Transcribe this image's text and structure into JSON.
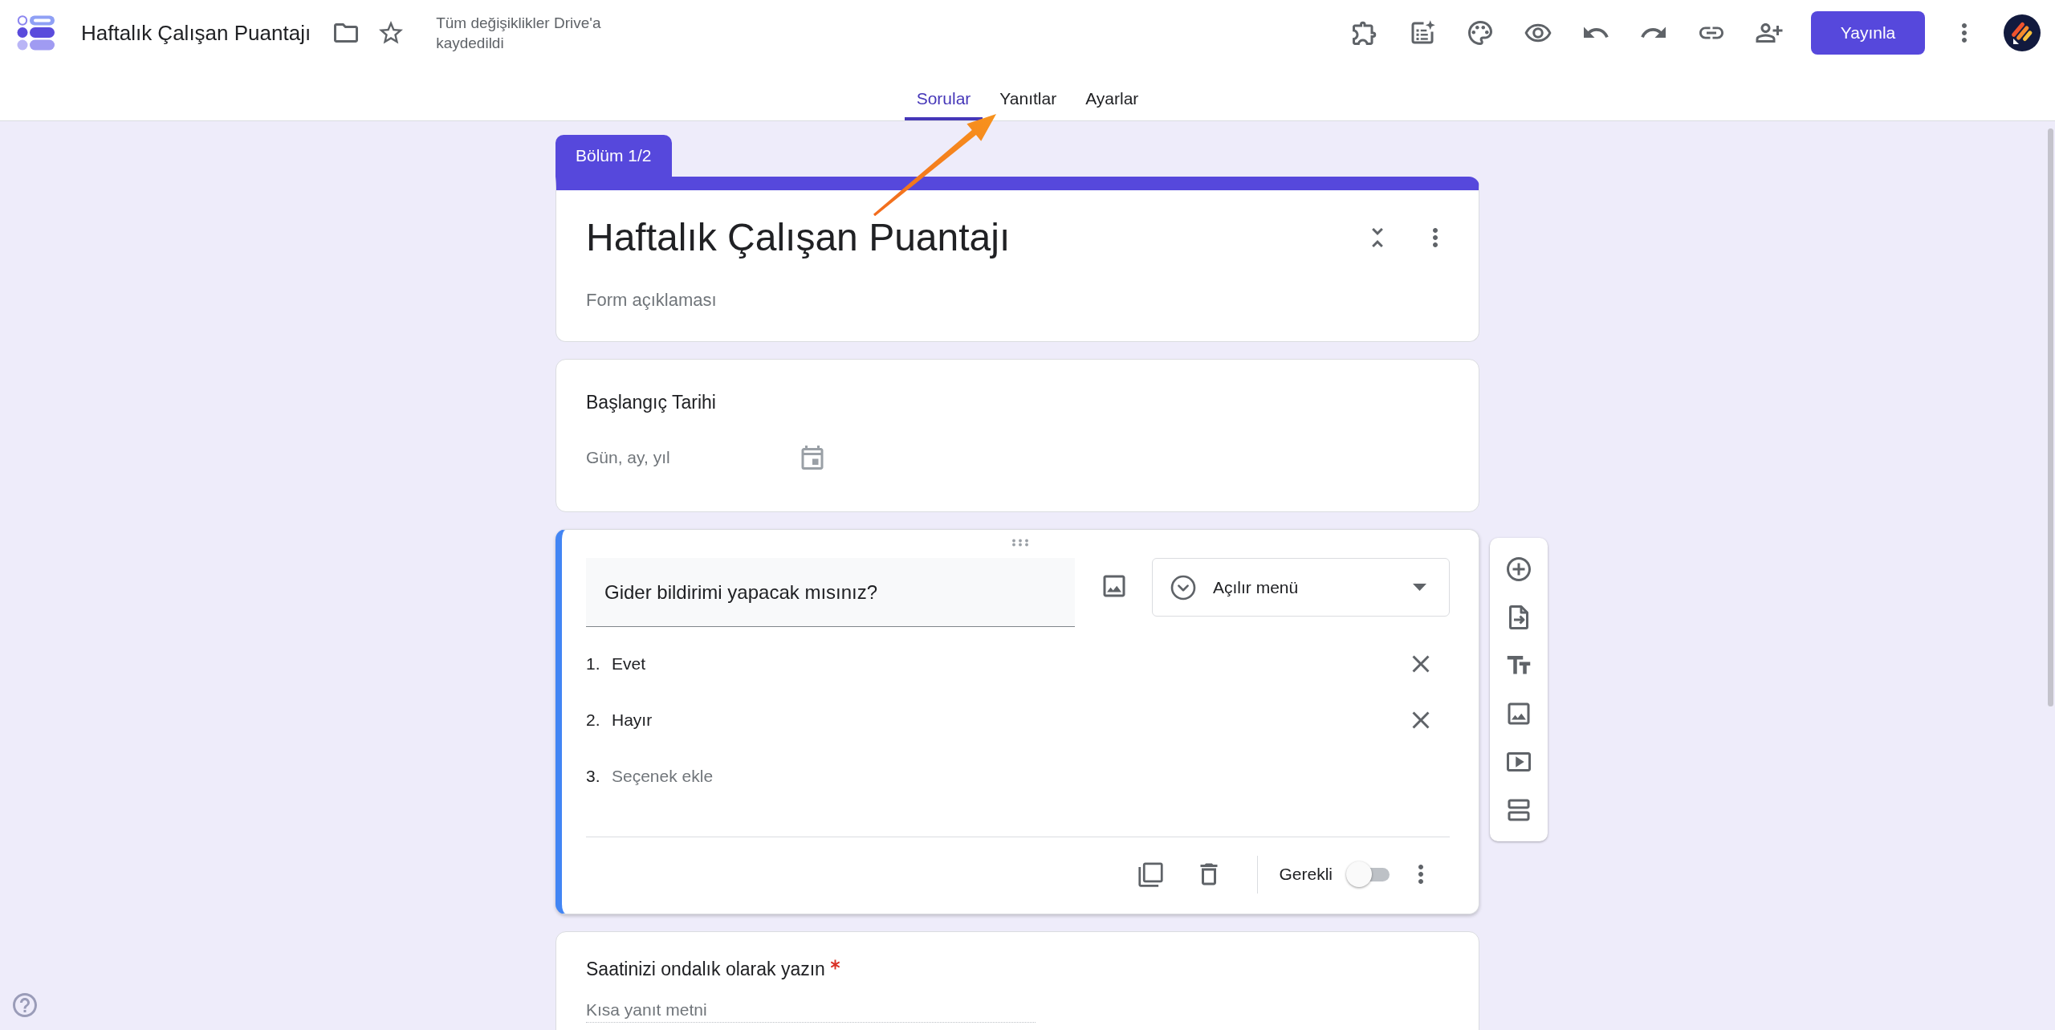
{
  "app_bar": {
    "title": "Haftalık Çalışan Puantajı",
    "starred": false,
    "save_status": "Tüm değişiklikler Drive'a kaydedildi",
    "publish_button": "Yayınla"
  },
  "tabs": [
    {
      "label": "Sorular",
      "selected": true
    },
    {
      "label": "Yanıtlar",
      "selected": false
    },
    {
      "label": "Ayarlar",
      "selected": false
    }
  ],
  "section": {
    "label": "Bölüm 1/2"
  },
  "form_header": {
    "title": "Haftalık Çalışan Puantajı",
    "description": {
      "placeholder": "Form açıklaması"
    }
  },
  "questions": [
    {
      "kind": "date",
      "active": false,
      "title": "Başlangıç Tarihi",
      "required": false,
      "placeholder": "Gün, ay, yıl"
    },
    {
      "kind": "dropdown",
      "active": true,
      "title": "Gider bildirimi yapacak mısınız?",
      "type_label": "Açılır menü",
      "options": [
        {
          "number": "1.",
          "label": "Evet"
        },
        {
          "number": "2.",
          "label": "Hayır"
        }
      ],
      "add_option": {
        "number": "3.",
        "label": "Seçenek ekle"
      },
      "required_label": "Gerekli",
      "required": false
    },
    {
      "kind": "short_answer",
      "active": false,
      "title": "Saatinizi ondalık olarak yazın",
      "required": true,
      "placeholder": "Kısa yanıt metni"
    }
  ]
}
